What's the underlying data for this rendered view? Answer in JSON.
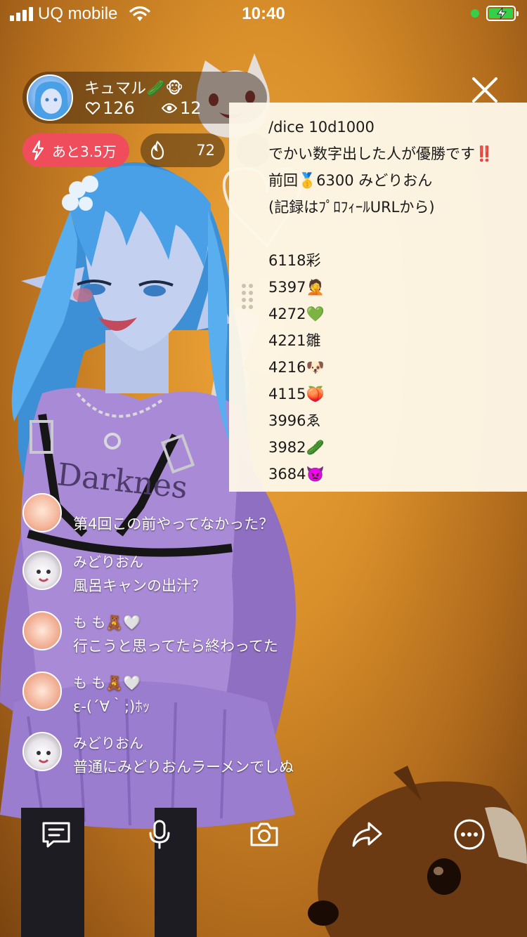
{
  "status_bar": {
    "carrier": "UQ mobile",
    "time": "10:40"
  },
  "host": {
    "name": "キュマル🥒🐵",
    "likes": "126",
    "viewers": "12"
  },
  "badges": {
    "goal_label": "あと3.5万",
    "fire_count": "72"
  },
  "pinned": {
    "lines": [
      "/dice 10d1000",
      "でかい数字出した人が優勝です‼️",
      "前回🥇6300 みどりおん",
      "(記録はﾌﾟﾛﾌｨｰﾙURLから)",
      "",
      "6118彩",
      "5397🤦",
      "4272💚",
      "4221雛",
      "4216🐶",
      "4115🍑",
      "3996ゑ",
      "3982🥒",
      "3684👿"
    ]
  },
  "comments": [
    {
      "name": "",
      "text": "第4回この前やってなかった？"
    },
    {
      "name": "みどりおん",
      "text": "風呂キャンの出汁？"
    },
    {
      "name": "も も🧸🤍",
      "text": "行こうと思ってたら終わってた"
    },
    {
      "name": "も も🧸🤍",
      "text": "ε-(´∀｀;)ﾎｯ"
    },
    {
      "name": "みどりおん",
      "text": "普通にみどりおんラーメンでしぬ"
    }
  ],
  "toolbar": {
    "icons": [
      "comment-icon",
      "microphone-icon",
      "camera-icon",
      "share-icon",
      "more-icon"
    ]
  },
  "colors": {
    "background": "#d98f2a",
    "goal_pill": "#ef4d5c",
    "panel": "#fdf7e8",
    "battery": "#35d04a"
  }
}
